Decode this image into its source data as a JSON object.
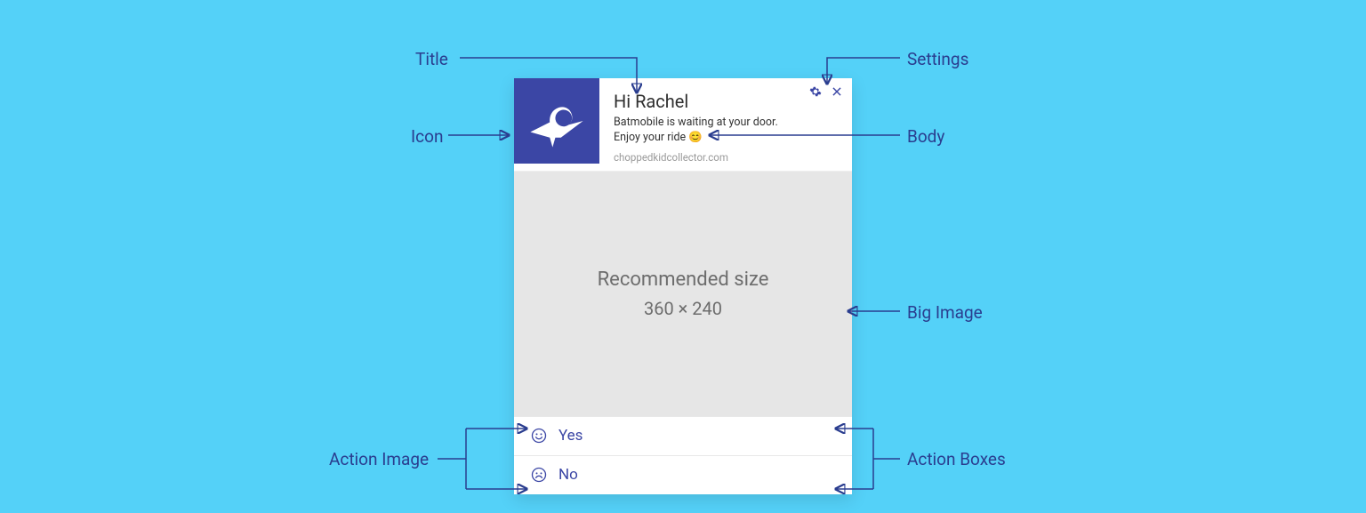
{
  "notification": {
    "title": "Hi Rachel",
    "body_line1": "Batmobile is waiting at your door.",
    "body_line2": "Enjoy your ride ",
    "body_emoji": "😊",
    "domain": "choppedkidcollector.com",
    "big_image": {
      "line1": "Recommended size",
      "line2": "360 × 240"
    },
    "actions": [
      {
        "label": "Yes",
        "icon": "smile"
      },
      {
        "label": "No",
        "icon": "frown"
      }
    ]
  },
  "annotations": {
    "title": "Title",
    "settings": "Settings",
    "icon": "Icon",
    "body": "Body",
    "big_image": "Big Image",
    "action_image": "Action Image",
    "action_boxes": "Action Boxes"
  }
}
